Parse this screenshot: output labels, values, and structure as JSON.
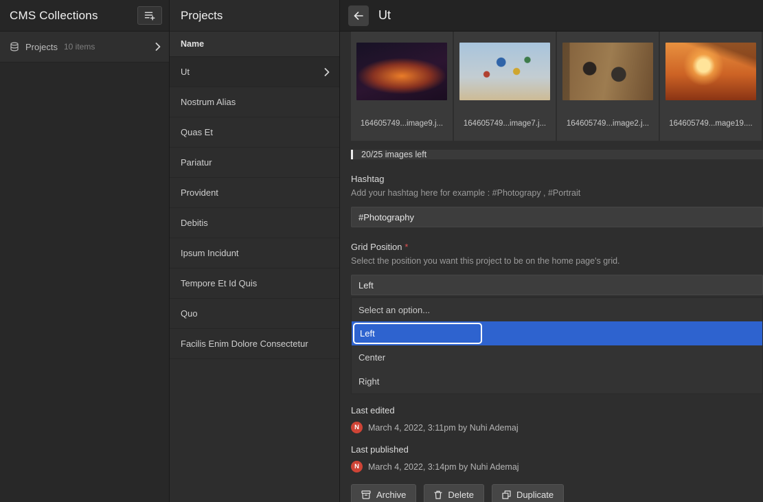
{
  "left_panel": {
    "title": "CMS Collections",
    "collections": [
      {
        "label": "Projects",
        "count": "10 items"
      }
    ]
  },
  "middle_panel": {
    "title": "Projects",
    "column_header": "Name",
    "selected_item": "Ut",
    "items": [
      "Ut",
      "Nostrum Alias",
      "Quas Et",
      "Pariatur",
      "Provident",
      "Debitis",
      "Ipsum Incidunt",
      "Tempore Et Id Quis",
      "Quo",
      "Facilis Enim Dolore Consectetur"
    ]
  },
  "detail_panel": {
    "title": "Ut",
    "images": [
      {
        "filename": "164605749...image9.j..."
      },
      {
        "filename": "164605749...image7.j..."
      },
      {
        "filename": "164605749...image2.j..."
      },
      {
        "filename": "164605749...mage19...."
      }
    ],
    "images_note": "20/25 images left",
    "hashtag_field": {
      "label": "Hashtag",
      "help": "Add your hashtag here for example : #Photograpy , #Portrait",
      "value": "#Photography"
    },
    "grid_position_field": {
      "label": "Grid Position",
      "required_mark": "*",
      "help": "Select the position you want this project to be on the home page's grid.",
      "value": "Left",
      "options": [
        "Select an option...",
        "Left",
        "Center",
        "Right"
      ],
      "selected_option": "Left"
    },
    "last_edited": {
      "label": "Last edited",
      "avatar_initial": "N",
      "text": "March 4, 2022, 3:11pm by Nuhi Ademaj"
    },
    "last_published": {
      "label": "Last published",
      "avatar_initial": "N",
      "text": "March 4, 2022, 3:14pm by Nuhi Ademaj"
    },
    "actions": [
      {
        "label": "Archive"
      },
      {
        "label": "Delete"
      },
      {
        "label": "Duplicate"
      }
    ]
  },
  "colors": {
    "selected_option_blue": "#2e63cf",
    "avatar_red": "#cf4436",
    "required_red": "#e05252"
  }
}
